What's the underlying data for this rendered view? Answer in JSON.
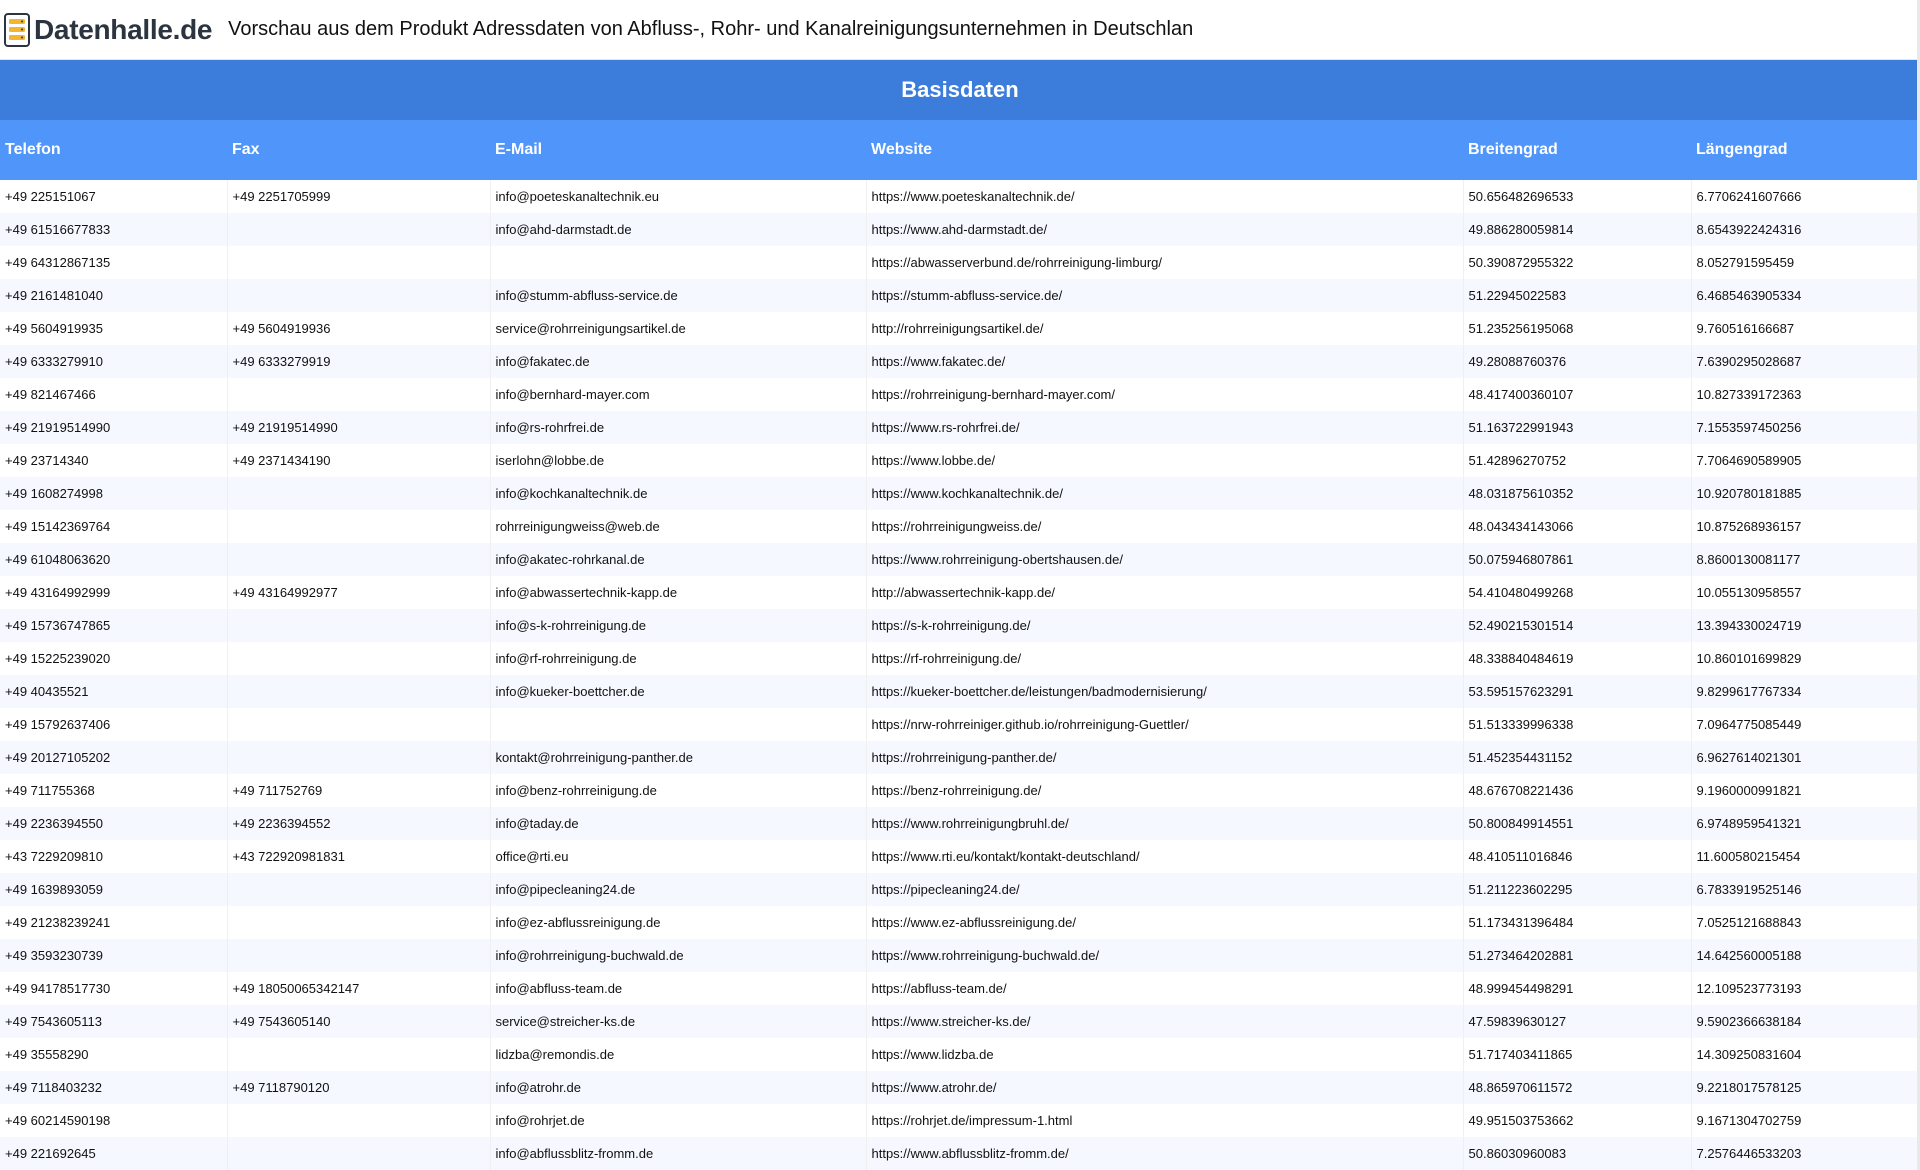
{
  "header": {
    "logo_text": "Datenhalle.de",
    "title": "Vorschau aus dem Produkt Adressdaten von Abfluss-, Rohr- und Kanalreinigungsunternehmen in Deutschlan"
  },
  "section": {
    "title": "Basisdaten"
  },
  "table": {
    "columns": [
      "Telefon",
      "Fax",
      "E-Mail",
      "Website",
      "Breitengrad",
      "Längengrad"
    ],
    "rows": [
      [
        "+49 225151067",
        "+49 2251705999",
        "info@poeteskanaltechnik.eu",
        "https://www.poeteskanaltechnik.de/",
        "50.656482696533",
        "6.7706241607666"
      ],
      [
        "+49 61516677833",
        "",
        "info@ahd-darmstadt.de",
        "https://www.ahd-darmstadt.de/",
        "49.886280059814",
        "8.6543922424316"
      ],
      [
        "+49 64312867135",
        "",
        "",
        "https://abwasserverbund.de/rohrreinigung-limburg/",
        "50.390872955322",
        "8.052791595459"
      ],
      [
        "+49 2161481040",
        "",
        "info@stumm-abfluss-service.de",
        "https://stumm-abfluss-service.de/",
        "51.22945022583",
        "6.4685463905334"
      ],
      [
        "+49 5604919935",
        "+49 5604919936",
        "service@rohrreinigungsartikel.de",
        "http://rohrreinigungsartikel.de/",
        "51.235256195068",
        "9.760516166687"
      ],
      [
        "+49 6333279910",
        "+49 6333279919",
        "info@fakatec.de",
        "https://www.fakatec.de/",
        "49.28088760376",
        "7.6390295028687"
      ],
      [
        "+49 821467466",
        "",
        "info@bernhard-mayer.com",
        "https://rohrreinigung-bernhard-mayer.com/",
        "48.417400360107",
        "10.827339172363"
      ],
      [
        "+49 21919514990",
        "+49 21919514990",
        "info@rs-rohrfrei.de",
        "https://www.rs-rohrfrei.de/",
        "51.163722991943",
        "7.1553597450256"
      ],
      [
        "+49 23714340",
        "+49 2371434190",
        "iserlohn@lobbe.de",
        "https://www.lobbe.de/",
        "51.42896270752",
        "7.7064690589905"
      ],
      [
        "+49 1608274998",
        "",
        "info@kochkanaltechnik.de",
        "https://www.kochkanaltechnik.de/",
        "48.031875610352",
        "10.920780181885"
      ],
      [
        "+49 15142369764",
        "",
        "rohrreinigungweiss@web.de",
        "https://rohrreinigungweiss.de/",
        "48.043434143066",
        "10.875268936157"
      ],
      [
        "+49 61048063620",
        "",
        "info@akatec-rohrkanal.de",
        "https://www.rohrreinigung-obertshausen.de/",
        "50.075946807861",
        "8.8600130081177"
      ],
      [
        "+49 43164992999",
        "+49 43164992977",
        "info@abwassertechnik-kapp.de",
        "http://abwassertechnik-kapp.de/",
        "54.410480499268",
        "10.055130958557"
      ],
      [
        "+49 15736747865",
        "",
        "info@s-k-rohrreinigung.de",
        "https://s-k-rohrreinigung.de/",
        "52.490215301514",
        "13.394330024719"
      ],
      [
        "+49 15225239020",
        "",
        "info@rf-rohrreinigung.de",
        "https://rf-rohrreinigung.de/",
        "48.338840484619",
        "10.860101699829"
      ],
      [
        "+49 40435521",
        "",
        "info@kueker-boettcher.de",
        "https://kueker-boettcher.de/leistungen/badmodernisierung/",
        "53.595157623291",
        "9.8299617767334"
      ],
      [
        "+49 15792637406",
        "",
        "",
        "https://nrw-rohrreiniger.github.io/rohrreinigung-Guettler/",
        "51.513339996338",
        "7.0964775085449"
      ],
      [
        "+49 20127105202",
        "",
        "kontakt@rohrreinigung-panther.de",
        "https://rohrreinigung-panther.de/",
        "51.452354431152",
        "6.9627614021301"
      ],
      [
        "+49 711755368",
        "+49 711752769",
        "info@benz-rohrreinigung.de",
        "https://benz-rohrreinigung.de/",
        "48.676708221436",
        "9.1960000991821"
      ],
      [
        "+49 2236394550",
        "+49 2236394552",
        "info@taday.de",
        "https://www.rohrreinigungbruhl.de/",
        "50.800849914551",
        "6.9748959541321"
      ],
      [
        "+43 7229209810",
        "+43 722920981831",
        "office@rti.eu",
        "https://www.rti.eu/kontakt/kontakt-deutschland/",
        "48.410511016846",
        "11.600580215454"
      ],
      [
        "+49 1639893059",
        "",
        "info@pipecleaning24.de",
        "https://pipecleaning24.de/",
        "51.211223602295",
        "6.7833919525146"
      ],
      [
        "+49 21238239241",
        "",
        "info@ez-abflussreinigung.de",
        "https://www.ez-abflussreinigung.de/",
        "51.173431396484",
        "7.0525121688843"
      ],
      [
        "+49 3593230739",
        "",
        "info@rohrreinigung-buchwald.de",
        "https://www.rohrreinigung-buchwald.de/",
        "51.273464202881",
        "14.642560005188"
      ],
      [
        "+49 94178517730",
        "+49 18050065342147",
        "info@abfluss-team.de",
        "https://abfluss-team.de/",
        "48.999454498291",
        "12.109523773193"
      ],
      [
        "+49 7543605113",
        "+49 7543605140",
        "service@streicher-ks.de",
        "https://www.streicher-ks.de/",
        "47.59839630127",
        "9.5902366638184"
      ],
      [
        "+49 35558290",
        "",
        "lidzba@remondis.de",
        "https://www.lidzba.de",
        "51.717403411865",
        "14.309250831604"
      ],
      [
        "+49 7118403232",
        "+49 7118790120",
        "info@atrohr.de",
        "https://www.atrohr.de/",
        "48.865970611572",
        "9.2218017578125"
      ],
      [
        "+49 60214590198",
        "",
        "info@rohrjet.de",
        "https://rohrjet.de/impressum-1.html",
        "49.951503753662",
        "9.1671304702759"
      ],
      [
        "+49 221692645",
        "",
        "info@abflussblitz-fromm.de",
        "https://www.abflussblitz-fromm.de/",
        "50.86030960083",
        "7.2576446533203"
      ]
    ]
  }
}
